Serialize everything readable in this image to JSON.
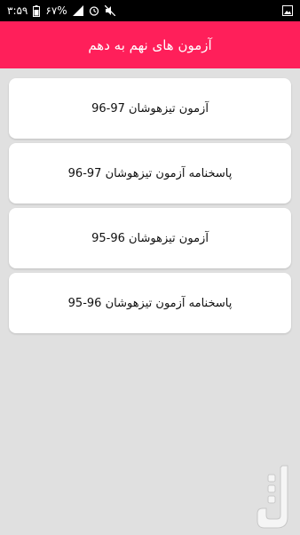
{
  "status_bar": {
    "time": "۳:۵۹",
    "battery": "۶۷%",
    "icons": [
      "signal-icon",
      "battery-icon",
      "no-signal-icon",
      "alarm-icon",
      "mute-icon",
      "image-notification-icon"
    ]
  },
  "app_bar": {
    "title": "آزمون های نهم به دهم"
  },
  "items": [
    {
      "label": "آزمون تیزهوشان 97-96"
    },
    {
      "label": "پاسخنامه آزمون تیزهوشان 97-96"
    },
    {
      "label": "آزمون تیزهوشان 96-95"
    },
    {
      "label": "پاسخنامه آزمون تیزهوشان 96-95"
    }
  ],
  "colors": {
    "accent": "#ff1f5a",
    "background": "#e0e0e0",
    "card": "#ffffff"
  }
}
